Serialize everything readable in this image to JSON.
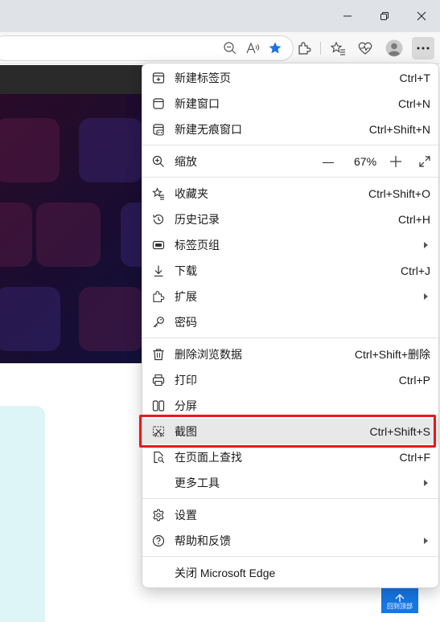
{
  "window": {
    "minimize_icon": "minimize-icon",
    "restore_icon": "restore-icon",
    "close_icon": "close-icon"
  },
  "toolbar": {
    "icons": [
      "zoom-out-icon",
      "read-aloud-icon",
      "favorite-star-icon",
      "extensions-icon",
      "favorites-icon",
      "browser-essentials-icon",
      "profile-avatar-icon",
      "more-options-icon"
    ],
    "star_color": "#1a73e8"
  },
  "menu": {
    "new_tab": {
      "label": "新建标签页",
      "shortcut": "Ctrl+T"
    },
    "new_window": {
      "label": "新建窗口",
      "shortcut": "Ctrl+N"
    },
    "new_inprivate": {
      "label": "新建无痕窗口",
      "shortcut": "Ctrl+Shift+N"
    },
    "zoom": {
      "label": "缩放",
      "minus": "—",
      "value": "67%"
    },
    "favorites": {
      "label": "收藏夹",
      "shortcut": "Ctrl+Shift+O"
    },
    "history": {
      "label": "历史记录",
      "shortcut": "Ctrl+H"
    },
    "tab_groups": {
      "label": "标签页组"
    },
    "downloads": {
      "label": "下载",
      "shortcut": "Ctrl+J"
    },
    "extensions": {
      "label": "扩展"
    },
    "passwords": {
      "label": "密码"
    },
    "clear_data": {
      "label": "删除浏览数据",
      "shortcut": "Ctrl+Shift+删除"
    },
    "print": {
      "label": "打印",
      "shortcut": "Ctrl+P"
    },
    "split_screen": {
      "label": "分屏"
    },
    "screenshot": {
      "label": "截图",
      "shortcut": "Ctrl+Shift+S"
    },
    "find_on_page": {
      "label": "在页面上查找",
      "shortcut": "Ctrl+F"
    },
    "more_tools": {
      "label": "更多工具"
    },
    "settings": {
      "label": "设置"
    },
    "help": {
      "label": "帮助和反馈"
    },
    "close_edge": {
      "label": "关闭 Microsoft Edge"
    }
  },
  "highlight_color": "#e8181d",
  "page": {
    "back_to_top": "回到顶部"
  }
}
